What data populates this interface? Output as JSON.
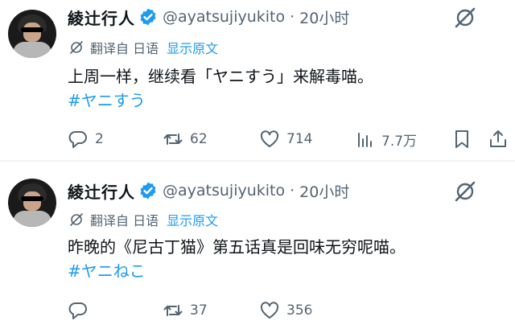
{
  "tweets": [
    {
      "author_name": "綾辻行人",
      "handle": "@ayatsujiyukito",
      "separator": "·",
      "time": "20小时",
      "translate_label": "翻译自 日语",
      "translate_link": "显示原文",
      "text": "上周一样，继续看「ヤニすう」来解毒喵。",
      "hashtag": "#ヤニすう",
      "stats": {
        "replies": "2",
        "retweets": "62",
        "likes": "714",
        "views": "7.7万"
      }
    },
    {
      "author_name": "綾辻行人",
      "handle": "@ayatsujiyukito",
      "separator": "·",
      "time": "20小时",
      "translate_label": "翻译自 日语",
      "translate_link": "显示原文",
      "text": "昨晚的《尼古丁猫》第五话真是回味无穷呢喵。",
      "hashtag": "#ヤニねこ",
      "stats": {
        "replies": "",
        "retweets": "37",
        "likes": "356"
      }
    }
  ],
  "colors": {
    "link": "#1d9bf0",
    "secondary_text": "#536471",
    "verified": "#1d9bf0"
  },
  "icons": [
    "verified-badge-icon",
    "grok-icon",
    "translate-icon",
    "reply-icon",
    "retweet-icon",
    "like-icon",
    "views-icon",
    "bookmark-icon",
    "share-icon"
  ]
}
